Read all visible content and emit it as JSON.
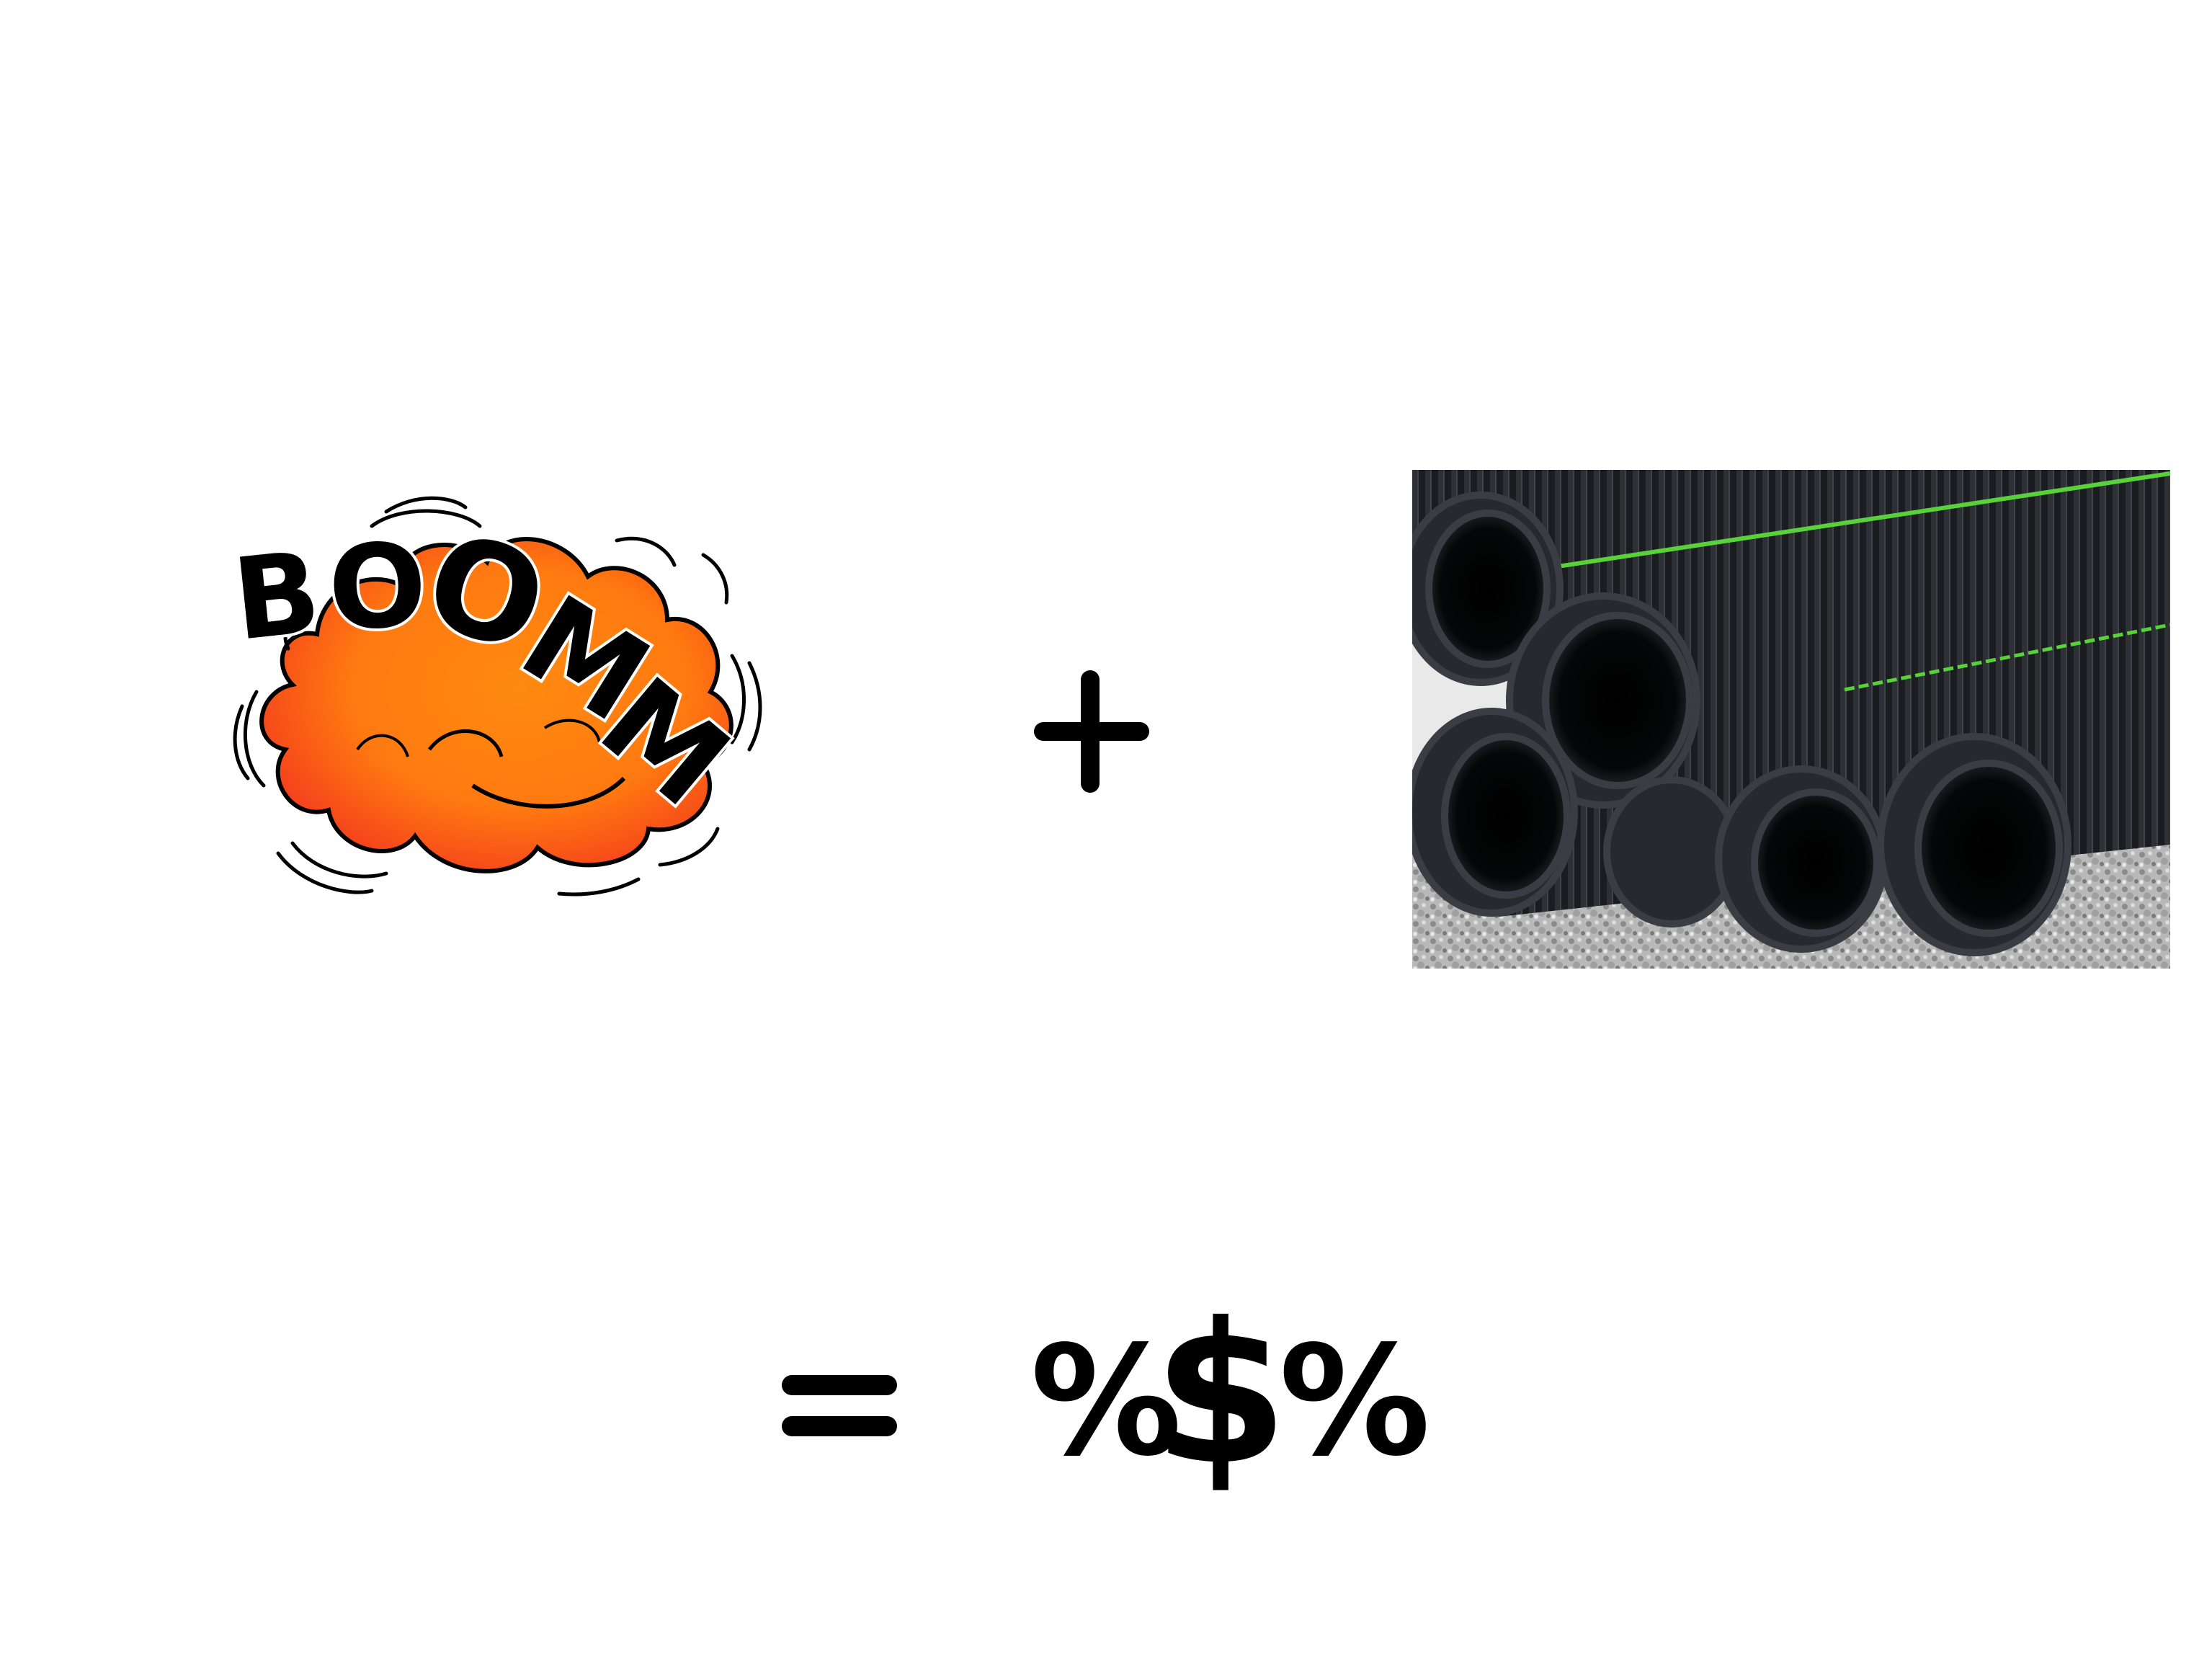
{
  "slide": {
    "boom_word": "BOOMM",
    "operator_plus": "+",
    "equals": "=",
    "result": {
      "percent_left": "%",
      "dollar": "$",
      "percent_right": "%"
    }
  },
  "colors": {
    "background": "#ffffff",
    "boom_orange": "#ff7a10",
    "boom_red": "#f2331f",
    "ink": "#000000",
    "pipe_black": "#141618",
    "pipe_stripe": "#58d13a",
    "gravel": "#b9b9b9"
  },
  "icons": {
    "boom": "comic-explosion",
    "pipes": "corrugated-pipes-photo"
  }
}
